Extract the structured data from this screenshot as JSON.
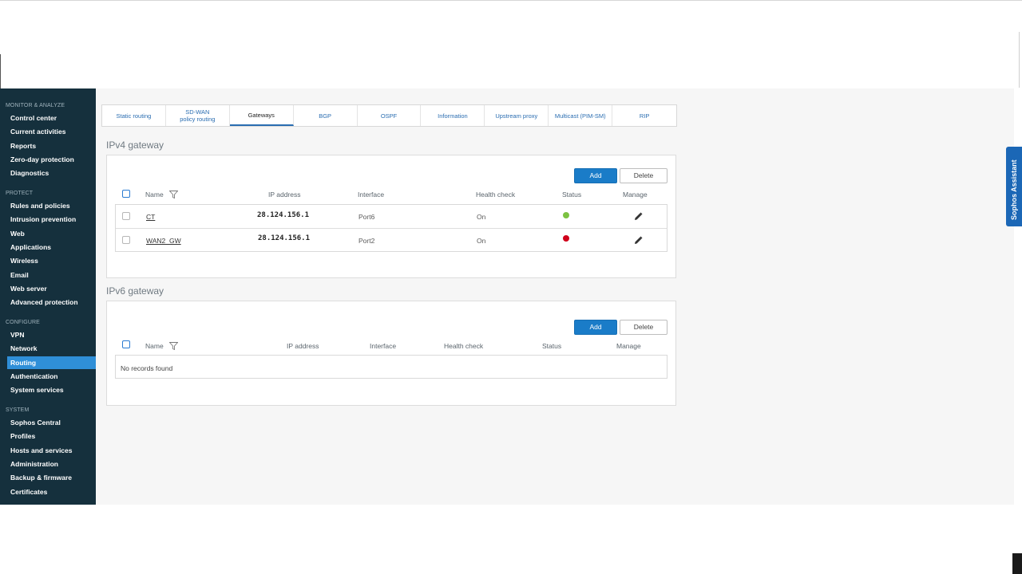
{
  "sidebar": {
    "groups": [
      {
        "title": "MONITOR & ANALYZE",
        "items": [
          "Control center",
          "Current activities",
          "Reports",
          "Zero-day protection",
          "Diagnostics"
        ]
      },
      {
        "title": "PROTECT",
        "items": [
          "Rules and policies",
          "Intrusion prevention",
          "Web",
          "Applications",
          "Wireless",
          "Email",
          "Web server",
          "Advanced protection"
        ]
      },
      {
        "title": "CONFIGURE",
        "items": [
          "VPN",
          "Network",
          "Routing",
          "Authentication",
          "System services"
        ]
      },
      {
        "title": "SYSTEM",
        "items": [
          "Sophos Central",
          "Profiles",
          "Hosts and services",
          "Administration",
          "Backup & firmware",
          "Certificates"
        ]
      }
    ],
    "active": "Routing"
  },
  "tabs": [
    {
      "label": "Static routing"
    },
    {
      "label": "SD-WAN policy routing"
    },
    {
      "label": "Gateways",
      "active": true
    },
    {
      "label": "BGP"
    },
    {
      "label": "OSPF"
    },
    {
      "label": "Information"
    },
    {
      "label": "Upstream proxy"
    },
    {
      "label": "Multicast (PIM-SM)"
    },
    {
      "label": "RIP"
    }
  ],
  "ipv4": {
    "title": "IPv4 gateway",
    "add_label": "Add",
    "delete_label": "Delete",
    "columns": {
      "name": "Name",
      "ip": "IP address",
      "interface": "Interface",
      "health": "Health check",
      "status": "Status",
      "manage": "Manage"
    },
    "rows": [
      {
        "name": "CT",
        "ip": "28.124.156.1",
        "interface": "Port6",
        "health": "On",
        "status_color": "#7cc242"
      },
      {
        "name": "WAN2_GW",
        "ip": "28.124.156.1",
        "interface": "Port2",
        "health": "On",
        "status_color": "#d0021b"
      }
    ]
  },
  "ipv6": {
    "title": "IPv6 gateway",
    "add_label": "Add",
    "delete_label": "Delete",
    "columns": {
      "name": "Name",
      "ip": "IP address",
      "interface": "Interface",
      "health": "Health check",
      "status": "Status",
      "manage": "Manage"
    },
    "empty": "No records found"
  },
  "assistant": {
    "label": "Sophos Assistant"
  },
  "colors": {
    "sidebar_bg": "#15303d",
    "accent": "#2f8fd8",
    "add_button": "#1a7cc8"
  }
}
